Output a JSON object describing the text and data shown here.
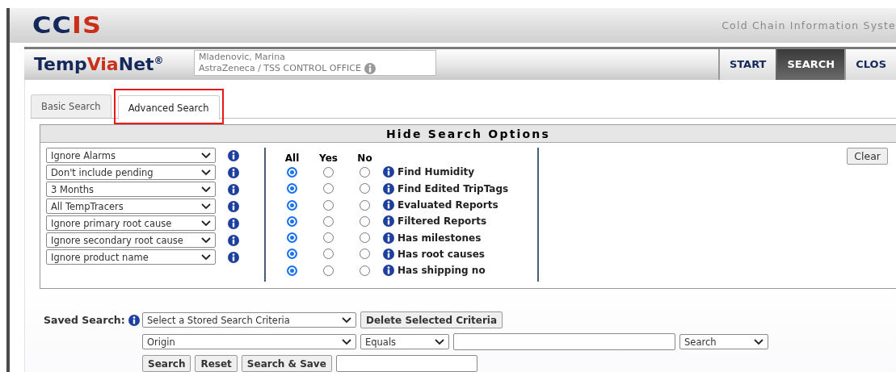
{
  "header": {
    "logo": [
      {
        "text": "CC",
        "color": "#14285a"
      },
      {
        "text": "IS",
        "color": "#c9301c"
      }
    ],
    "tagline": "Cold Chain Information Syste"
  },
  "navbar": {
    "brand": [
      {
        "text": "Temp",
        "color": "#14285a"
      },
      {
        "text": "Via",
        "color": "#c9301c"
      },
      {
        "text": "Net$^{®}$",
        "color": "#14285a"
      }
    ],
    "user": {
      "name": "Mladenovic, Marina",
      "organization": "AstraZeneca / TSS CONTROL OFFICE"
    },
    "buttons": [
      {
        "label": "START",
        "selected": false
      },
      {
        "label": "SEARCH",
        "selected": true
      },
      {
        "label": "CLOS",
        "selected": false
      }
    ]
  },
  "tabs": [
    {
      "label": "Basic Search",
      "selected": false,
      "highlighted": false
    },
    {
      "label": "Advanced Search",
      "selected": true,
      "highlighted": true
    }
  ],
  "options": {
    "title": "Hide Search Options",
    "filters": [
      "Ignore Alarms",
      "Don't include pending",
      "3 Months",
      "All TempTracers",
      "Ignore primary root cause",
      "Ignore secondary root cause",
      "Ignore product name"
    ],
    "radio_columns": [
      "All",
      "Yes",
      "No"
    ],
    "flags": [
      {
        "label": "Find Humidity",
        "radios": [
          {
            "selected": true
          },
          {
            "selected": false
          },
          {
            "selected": false
          }
        ]
      },
      {
        "label": "Find Edited TripTags",
        "radios": [
          {
            "selected": true
          },
          {
            "selected": false
          },
          {
            "selected": false
          }
        ]
      },
      {
        "label": "Evaluated Reports",
        "radios": [
          {
            "selected": true
          },
          {
            "selected": false
          },
          {
            "selected": false
          }
        ]
      },
      {
        "label": "Filtered Reports",
        "radios": [
          {
            "selected": true
          },
          {
            "selected": false
          },
          {
            "selected": false
          }
        ]
      },
      {
        "label": "Has milestones",
        "radios": [
          {
            "selected": true
          },
          {
            "selected": false
          },
          {
            "selected": false
          }
        ]
      },
      {
        "label": "Has root causes",
        "radios": [
          {
            "selected": true
          },
          {
            "selected": false
          },
          {
            "selected": false
          }
        ]
      },
      {
        "label": "Has shipping no",
        "radios": [
          {
            "selected": true
          },
          {
            "selected": false
          },
          {
            "selected": false
          }
        ]
      }
    ],
    "clear_button": "Clear"
  },
  "saved_search": {
    "label": "Saved Search:",
    "stored_criteria": "Select a Stored Search Criteria",
    "delete_button": "Delete Selected Criteria",
    "field": "Origin",
    "operator": "Equals",
    "mode": "Search",
    "buttons": [
      "Search",
      "Reset",
      "Search & Save"
    ]
  }
}
